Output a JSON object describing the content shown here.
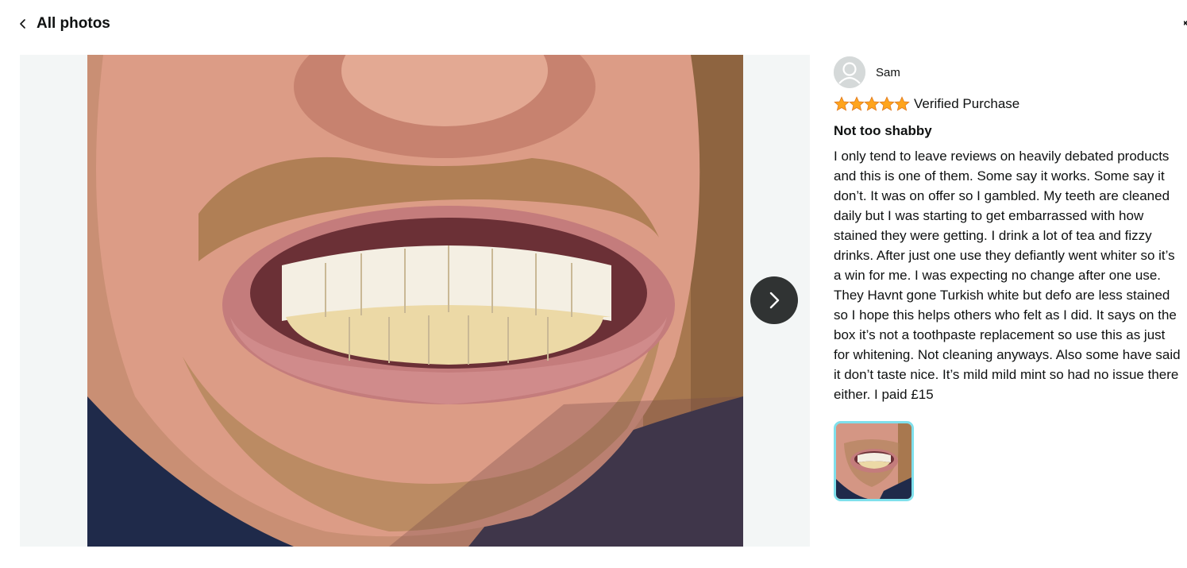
{
  "header": {
    "back_label": "All photos"
  },
  "viewer": {
    "next_icon": "chevron-right-icon",
    "photo_description": "customer photo of teeth"
  },
  "review": {
    "reviewer_name": "Sam",
    "rating": 5,
    "rating_max": 5,
    "verified_label": "Verified Purchase",
    "title": "Not too shabby",
    "body": "I only tend to leave reviews on heavily debated products and this is one of them. Some say it works. Some say it don’t. It was on offer so I gambled. My teeth are cleaned daily but I was starting to get embarrassed with how stained they were getting. I drink a lot of tea and fizzy drinks. After just one use they defiantly went whiter so it’s a win for me. I was expecting no change after one use. They Havnt gone Turkish white but defo are less stained so I hope this helps others who felt as I did. It says on the box it’s not a toothpaste replacement so use this as just for whitening. Not cleaning anyways. Also some have said it don’t taste nice. It’s mild mild mint so had no issue there either. I paid £15"
  },
  "colors": {
    "star": "#ffa41c",
    "next_button": "#303333",
    "thumb_border": "#7fe0ec",
    "viewer_bg": "#f3f6f6"
  }
}
